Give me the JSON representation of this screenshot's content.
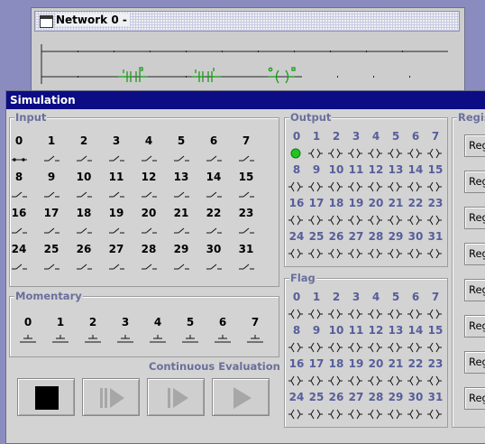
{
  "network": {
    "title": "Network 0 -"
  },
  "simulation": {
    "title": "Simulation",
    "input": {
      "title": "Input",
      "labels": [
        "0",
        "1",
        "2",
        "3",
        "4",
        "5",
        "6",
        "7",
        "8",
        "9",
        "10",
        "11",
        "12",
        "13",
        "14",
        "15",
        "16",
        "17",
        "18",
        "19",
        "20",
        "21",
        "22",
        "23",
        "24",
        "25",
        "26",
        "27",
        "28",
        "29",
        "30",
        "31"
      ]
    },
    "momentary": {
      "title": "Momentary",
      "labels": [
        "0",
        "1",
        "2",
        "3",
        "4",
        "5",
        "6",
        "7"
      ]
    },
    "output": {
      "title": "Output",
      "labels": [
        "0",
        "1",
        "2",
        "3",
        "4",
        "5",
        "6",
        "7",
        "8",
        "9",
        "10",
        "11",
        "12",
        "13",
        "14",
        "15",
        "16",
        "17",
        "18",
        "19",
        "20",
        "21",
        "22",
        "23",
        "24",
        "25",
        "26",
        "27",
        "28",
        "29",
        "30",
        "31"
      ],
      "active": [
        0
      ]
    },
    "flag": {
      "title": "Flag",
      "labels": [
        "0",
        "1",
        "2",
        "3",
        "4",
        "5",
        "6",
        "7",
        "8",
        "9",
        "10",
        "11",
        "12",
        "13",
        "14",
        "15",
        "16",
        "17",
        "18",
        "19",
        "20",
        "21",
        "22",
        "23",
        "24",
        "25",
        "26",
        "27",
        "28",
        "29",
        "30",
        "31"
      ]
    },
    "register": {
      "title": "Regis",
      "button_label": "Reg"
    },
    "continuous_label": "Continuous Evaluation",
    "buttons": [
      "stop-icon",
      "step-run-icon",
      "step-icon",
      "run-icon"
    ],
    "colors": {
      "title_bar": "#0c0c84",
      "active_output": "#22c322",
      "ladder_green": "#1a9a1a",
      "panel_label": "#6a6f9c"
    }
  }
}
